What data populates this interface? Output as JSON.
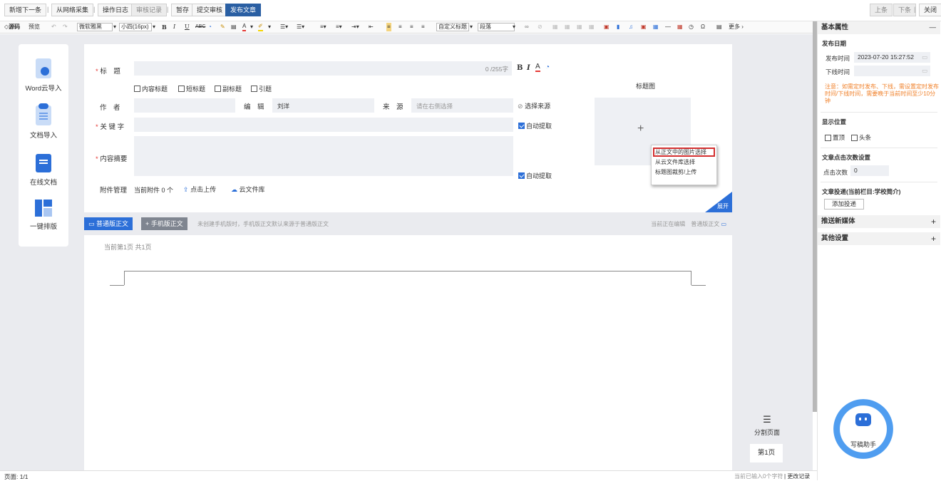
{
  "topbar": {
    "new_next": "新增下一条",
    "web_collect": "从网络采集",
    "op_log": "操作日志",
    "audit_log": "审核记录",
    "save_draft": "暂存",
    "submit_audit": "提交审核",
    "publish": "发布文章",
    "prev": "上条",
    "next": "下条",
    "close": "关闭"
  },
  "editor_toolbar": {
    "source": "◇源码",
    "preview": "预览",
    "font_family": "微软雅黑",
    "font_size": "小四(16px)",
    "custom_title": "自定义标题",
    "paragraph": "段落",
    "more": "更多"
  },
  "left_panel": {
    "items": [
      "Word云导入",
      "文档导入",
      "在线文档",
      "一键排版"
    ]
  },
  "form": {
    "title_label": "标　题",
    "title_count": "0 /255字",
    "checkboxes": [
      "内容标题",
      "短标题",
      "副标题",
      "引题"
    ],
    "author_label": "作　者",
    "editor_label": "编　辑",
    "editor_value": "刘洋",
    "source_label": "来　源",
    "source_placeholder": "请在右侧选择",
    "choose_source": "选择来源",
    "keyword_label": "关 键 字",
    "auto_extract": "自动提取",
    "summary_label": "内容摘要",
    "attach_label": "附件管理",
    "attach_count": "当前附件 0 个",
    "upload": "点击上传",
    "cloud_lib": "云文件库",
    "thumb_title": "标题图",
    "expand": "展开"
  },
  "context_menu": {
    "items": [
      "从正文中的图片选择",
      "从云文件库选择",
      "标题图裁剪/上传"
    ]
  },
  "tabs": {
    "normal": "普通版正文",
    "mobile": "+ 手机版正文",
    "hint": "未创建手机版时，手机版正文默认来源于普通版正文",
    "editing": "当前正在编辑　普通版正文"
  },
  "doc": {
    "page_info": "当前第1页 共1页",
    "split_page": "分割页面",
    "page1": "第1页"
  },
  "status": {
    "pages": "页面: 1/1",
    "chars": "当前已输入0个字符",
    "changes": "更改记录"
  },
  "right": {
    "basic_props": "基本属性",
    "publish_date": "发布日期",
    "publish_time_label": "发布时间",
    "publish_time": "2023-07-20 15:27:52",
    "offline_label": "下线时间",
    "note": "注意：如需定时发布、下线，需设置定时发布时间/下线时间，需要晚于当前时间至少10分钟",
    "display_pos": "显示位置",
    "pin_top": "置顶",
    "headline": "头条",
    "click_setting": "文章点击次数设置",
    "click_label": "点击次数",
    "click_value": "0",
    "deliver_label": "文章投递(当前栏目:学校简介)",
    "add_deliver": "添加投递",
    "push_media": "推送新媒体",
    "other_settings": "其他设置",
    "assistant": "写稿助手"
  },
  "colors": {
    "primary": "#2a5fa3",
    "accent_blue": "#2c6fd8",
    "note_orange": "#f0802a",
    "required_red": "#e53935"
  }
}
